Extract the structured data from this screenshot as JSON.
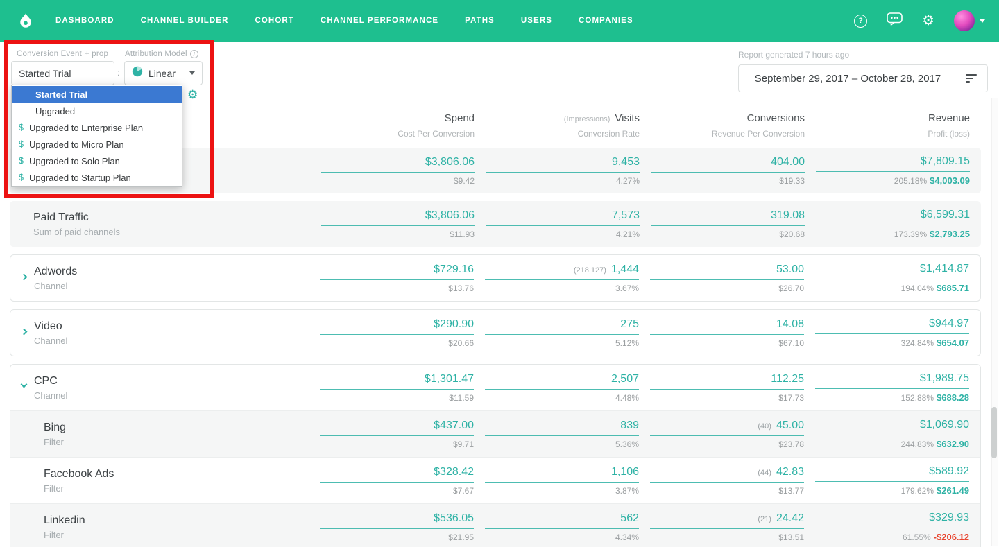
{
  "colors": {
    "nav": "#1ebf8f",
    "accent": "#2eb2a5",
    "negative": "#e8442e",
    "selected": "#3b79d2",
    "annotation": "#ec1212"
  },
  "nav": {
    "items": [
      "DASHBOARD",
      "CHANNEL BUILDER",
      "COHORT",
      "CHANNEL PERFORMANCE",
      "PATHS",
      "USERS",
      "COMPANIES"
    ],
    "help_icon": "?"
  },
  "filters": {
    "conversion_event_label": "Conversion Event",
    "prop_label": "+ prop",
    "attribution_model_label": "Attribution Model",
    "conversion_event_value": "Started Trial",
    "separator": ":",
    "model_value": "Linear",
    "dropdown": {
      "options": [
        {
          "label": "Started Trial",
          "selected": true,
          "dollar": false
        },
        {
          "label": "Upgraded",
          "selected": false,
          "dollar": false
        },
        {
          "label": "Upgraded to Enterprise Plan",
          "selected": false,
          "dollar": true
        },
        {
          "label": "Upgraded to Micro Plan",
          "selected": false,
          "dollar": true
        },
        {
          "label": "Upgraded to Solo Plan",
          "selected": false,
          "dollar": true
        },
        {
          "label": "Upgraded to Startup Plan",
          "selected": false,
          "dollar": true
        }
      ]
    },
    "report_generated": "Report generated 7 hours ago",
    "date_range": "September 29, 2017  –  October 28, 2017"
  },
  "table": {
    "headers": {
      "spend": "Spend",
      "spend_sub": "Cost Per Conversion",
      "visits_pre": "(Impressions)",
      "visits": "Visits",
      "visits_sub": "Conversion Rate",
      "conversions": "Conversions",
      "conversions_sub": "Revenue Per Conversion",
      "revenue": "Revenue",
      "revenue_sub": "Profit (loss)"
    },
    "rows": [
      {
        "name": "",
        "sub": "",
        "chevron": null,
        "indent": false,
        "shade": true,
        "block": "b1",
        "block_class": "shade-block",
        "cells": {
          "spend": {
            "main": "$3,806.06",
            "sub": "$9.42"
          },
          "visits": {
            "main": "9,453",
            "sub": "4.27%"
          },
          "conversions": {
            "main": "404.00",
            "sub": "$19.33"
          },
          "revenue": {
            "main": "$7,809.15",
            "pct": "205.18%",
            "amount": "$4,003.09",
            "negative": false
          }
        }
      },
      {
        "name": "Paid Traffic",
        "sub": "Sum of paid channels",
        "chevron": null,
        "indent": false,
        "shade": true,
        "block": "b2",
        "block_class": "shade-block",
        "cells": {
          "spend": {
            "main": "$3,806.06",
            "sub": "$11.93"
          },
          "visits": {
            "main": "7,573",
            "sub": "4.21%"
          },
          "conversions": {
            "main": "319.08",
            "sub": "$20.68"
          },
          "revenue": {
            "main": "$6,599.31",
            "pct": "173.39%",
            "amount": "$2,793.25",
            "negative": false
          }
        }
      },
      {
        "name": "Adwords",
        "sub": "Channel",
        "chevron": "right",
        "indent": false,
        "shade": false,
        "block": "b3",
        "block_class": "bordered",
        "cells": {
          "spend": {
            "main": "$729.16",
            "sub": "$13.76"
          },
          "visits": {
            "pre": "(218,127)",
            "main": "1,444",
            "sub": "3.67%"
          },
          "conversions": {
            "main": "53.00",
            "sub": "$26.70"
          },
          "revenue": {
            "main": "$1,414.87",
            "pct": "194.04%",
            "amount": "$685.71",
            "negative": false
          }
        }
      },
      {
        "name": "Video",
        "sub": "Channel",
        "chevron": "right",
        "indent": false,
        "shade": false,
        "block": "b4",
        "block_class": "bordered",
        "cells": {
          "spend": {
            "main": "$290.90",
            "sub": "$20.66"
          },
          "visits": {
            "main": "275",
            "sub": "5.12%"
          },
          "conversions": {
            "main": "14.08",
            "sub": "$67.10"
          },
          "revenue": {
            "main": "$944.97",
            "pct": "324.84%",
            "amount": "$654.07",
            "negative": false
          }
        }
      },
      {
        "name": "CPC",
        "sub": "Channel",
        "chevron": "down",
        "indent": false,
        "shade": false,
        "block": "b5",
        "block_class": "bordered",
        "cells": {
          "spend": {
            "main": "$1,301.47",
            "sub": "$11.59"
          },
          "visits": {
            "main": "2,507",
            "sub": "4.48%"
          },
          "conversions": {
            "main": "112.25",
            "sub": "$17.73"
          },
          "revenue": {
            "main": "$1,989.75",
            "pct": "152.88%",
            "amount": "$688.28",
            "negative": false
          }
        }
      },
      {
        "name": "Bing",
        "sub": "Filter",
        "chevron": null,
        "indent": true,
        "shade": true,
        "block": "b5",
        "block_class": "bordered",
        "cells": {
          "spend": {
            "main": "$437.00",
            "sub": "$9.71"
          },
          "visits": {
            "main": "839",
            "sub": "5.36%"
          },
          "conversions": {
            "pre": "(40)",
            "main": "45.00",
            "sub": "$23.78"
          },
          "revenue": {
            "main": "$1,069.90",
            "pct": "244.83%",
            "amount": "$632.90",
            "negative": false
          }
        }
      },
      {
        "name": "Facebook Ads",
        "sub": "Filter",
        "chevron": null,
        "indent": true,
        "shade": false,
        "block": "b5",
        "block_class": "bordered",
        "cells": {
          "spend": {
            "main": "$328.42",
            "sub": "$7.67"
          },
          "visits": {
            "main": "1,106",
            "sub": "3.87%"
          },
          "conversions": {
            "pre": "(44)",
            "main": "42.83",
            "sub": "$13.77"
          },
          "revenue": {
            "main": "$589.92",
            "pct": "179.62%",
            "amount": "$261.49",
            "negative": false
          }
        }
      },
      {
        "name": "Linkedin",
        "sub": "Filter",
        "chevron": null,
        "indent": true,
        "shade": true,
        "block": "b5",
        "block_class": "bordered",
        "cells": {
          "spend": {
            "main": "$536.05",
            "sub": "$21.95"
          },
          "visits": {
            "main": "562",
            "sub": "4.34%"
          },
          "conversions": {
            "pre": "(21)",
            "main": "24.42",
            "sub": "$13.51"
          },
          "revenue": {
            "main": "$329.93",
            "pct": "61.55%",
            "amount": "-$206.12",
            "negative": true
          }
        }
      }
    ]
  }
}
